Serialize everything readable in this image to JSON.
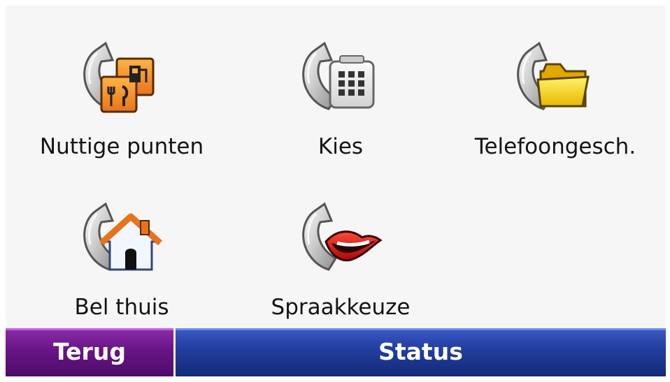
{
  "menu": {
    "items": [
      {
        "label": "Nuttige punten",
        "icon": "phone-poi-icon"
      },
      {
        "label": "Kies",
        "icon": "phone-keypad-icon"
      },
      {
        "label": "Telefoongesch.",
        "icon": "phone-folder-icon"
      },
      {
        "label": "Bel thuis",
        "icon": "phone-home-icon"
      },
      {
        "label": "Spraakkeuze",
        "icon": "phone-lips-icon"
      }
    ]
  },
  "footer": {
    "back_label": "Terug",
    "status_label": "Status"
  },
  "colors": {
    "back_button": "#6a1588",
    "status_button": "#223e9f",
    "background": "#f6f6f6"
  }
}
